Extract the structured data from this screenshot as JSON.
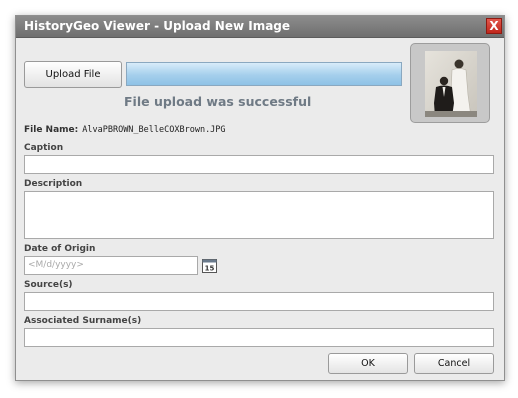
{
  "window": {
    "title": "HistoryGeo Viewer - Upload New Image",
    "close_glyph": "X"
  },
  "upload": {
    "button_label": "Upload File",
    "progress": 1.0,
    "status": "File upload was successful"
  },
  "file": {
    "label": "File Name:",
    "value": "AlvaPBROWN_BelleCOXBrown.JPG"
  },
  "caption": {
    "label": "Caption",
    "value": ""
  },
  "description": {
    "label": "Description",
    "value": ""
  },
  "date_of_origin": {
    "label": "Date of Origin",
    "placeholder": "<M/d/yyyy>",
    "calendar_day": "15"
  },
  "sources": {
    "label": "Source(s)",
    "value": ""
  },
  "surnames": {
    "label": "Associated Surname(s)",
    "value": ""
  },
  "actions": {
    "ok_label": "OK",
    "cancel_label": "Cancel"
  },
  "colors": {
    "titlebar": "#7f7f7f",
    "close": "#d53a2e",
    "progress_fill": "#a5cfec",
    "status_text": "#6f7a85"
  }
}
